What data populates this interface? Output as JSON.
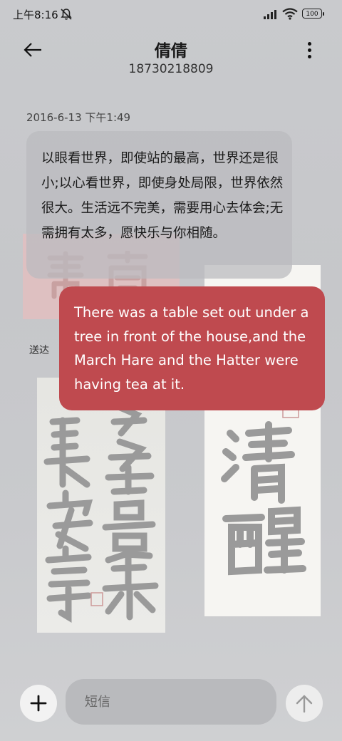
{
  "status_bar": {
    "time": "上午8:16",
    "battery": "100",
    "icons": [
      "mute-icon",
      "signal-icon",
      "wifi-icon",
      "battery-icon"
    ]
  },
  "header": {
    "contact_name": "倩倩",
    "contact_number": "18730218809",
    "back_icon": "arrow-left-icon",
    "more_icon": "more-vertical-icon"
  },
  "conversation": {
    "timestamp": "2016-6-13 下午1:49",
    "received_message": "以眼看世界，即使站的最高，世界还是很小;以心看世界，即使身处局限，世界依然很大。生活远不完美，需要用心去体会;无需拥有太多，愿快乐与你相随。",
    "sent_message": "There was a table set out under a tree in front of the house,and the March Hare and the Hatter were having tea at it.",
    "sent_status": "送达"
  },
  "input_bar": {
    "placeholder": "短信",
    "value": "",
    "add_icon": "plus-icon",
    "send_icon": "arrow-up-icon"
  },
  "colors": {
    "sent_bubble": "#bf4a4f",
    "received_bubble": "#bbbbbf",
    "background": "#c9cacd"
  }
}
